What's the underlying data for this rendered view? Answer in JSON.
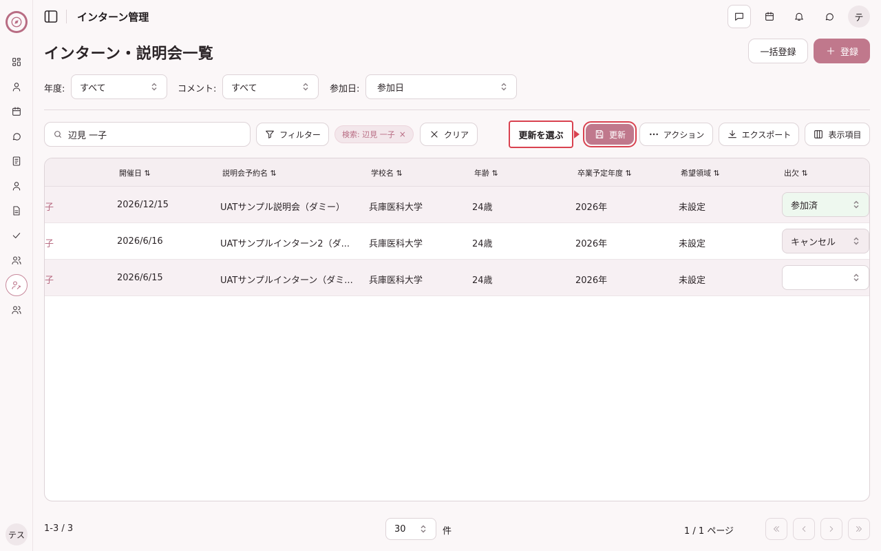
{
  "header": {
    "title": "インターン管理",
    "user_initial": "テ"
  },
  "sidebar": {
    "user_label": "テス"
  },
  "page": {
    "title": "インターン・説明会一覧",
    "bulk_register_label": "一括登録",
    "register_label": "登録"
  },
  "filters": {
    "year_label": "年度:",
    "year_value": "すべて",
    "comment_label": "コメント:",
    "comment_value": "すべて",
    "join_date_label": "参加日:",
    "join_date_value": "参加日"
  },
  "toolbar": {
    "search_value": "辺見 一子",
    "filter_label": "フィルター",
    "chip_label": "検索: 辺見 一子",
    "clear_label": "クリア",
    "callout_label": "更新を選ぶ",
    "update_label": "更新",
    "action_label": "アクション",
    "export_label": "エクスポート",
    "columns_label": "表示項目"
  },
  "table": {
    "headers": [
      "開催日 ⇅",
      "説明会予約名 ⇅",
      "学校名 ⇅",
      "年齢 ⇅",
      "卒業予定年度 ⇅",
      "希望領域 ⇅",
      "出欠 ⇅"
    ],
    "rows": [
      {
        "name_tail": "子",
        "date": "2026/12/15",
        "event": "UATサンプル説明会（ダミー）",
        "school": "兵庫医科大学",
        "age": "24歳",
        "grad": "2026年",
        "area": "未設定",
        "attendance": "参加済"
      },
      {
        "name_tail": "子",
        "date": "2026/6/16",
        "event": "UATサンプルインターン2（ダ...",
        "school": "兵庫医科大学",
        "age": "24歳",
        "grad": "2026年",
        "area": "未設定",
        "attendance": "キャンセル"
      },
      {
        "name_tail": "子",
        "date": "2026/6/15",
        "event": "UATサンプルインターン（ダミ...",
        "school": "兵庫医科大学",
        "age": "24歳",
        "grad": "2026年",
        "area": "未設定",
        "attendance": ""
      }
    ]
  },
  "pagination": {
    "range": "1-3 / 3",
    "page_size": "30",
    "unit": "件",
    "page_info": "1 / 1 ページ"
  },
  "colors": {
    "accent": "#c0788c",
    "highlight": "#d9414f"
  }
}
